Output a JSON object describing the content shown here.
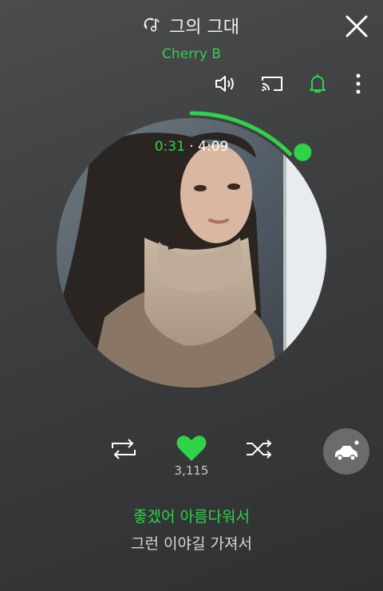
{
  "song": {
    "title": "그의 그대",
    "artist": "Cherry B"
  },
  "icons": {
    "title": "music-note-icon",
    "close": "close-icon",
    "volume": "speaker-icon",
    "cast": "cast-icon",
    "alarm": "bell-icon",
    "more": "more-vertical-icon",
    "repeat": "repeat-icon",
    "like": "heart-icon",
    "shuffle": "shuffle-icon",
    "car": "car-icon"
  },
  "playback": {
    "elapsed": "0:31",
    "separator": "·",
    "total": "4:09",
    "progress": 0.1245
  },
  "like_count": "3,115",
  "lyrics": {
    "current": "좋겠어 아름다워서",
    "next": "그런 이야길 가져서"
  },
  "colors": {
    "accent": "#2fd34a",
    "background": "#3c3d3f",
    "icon": "#ffffff"
  }
}
